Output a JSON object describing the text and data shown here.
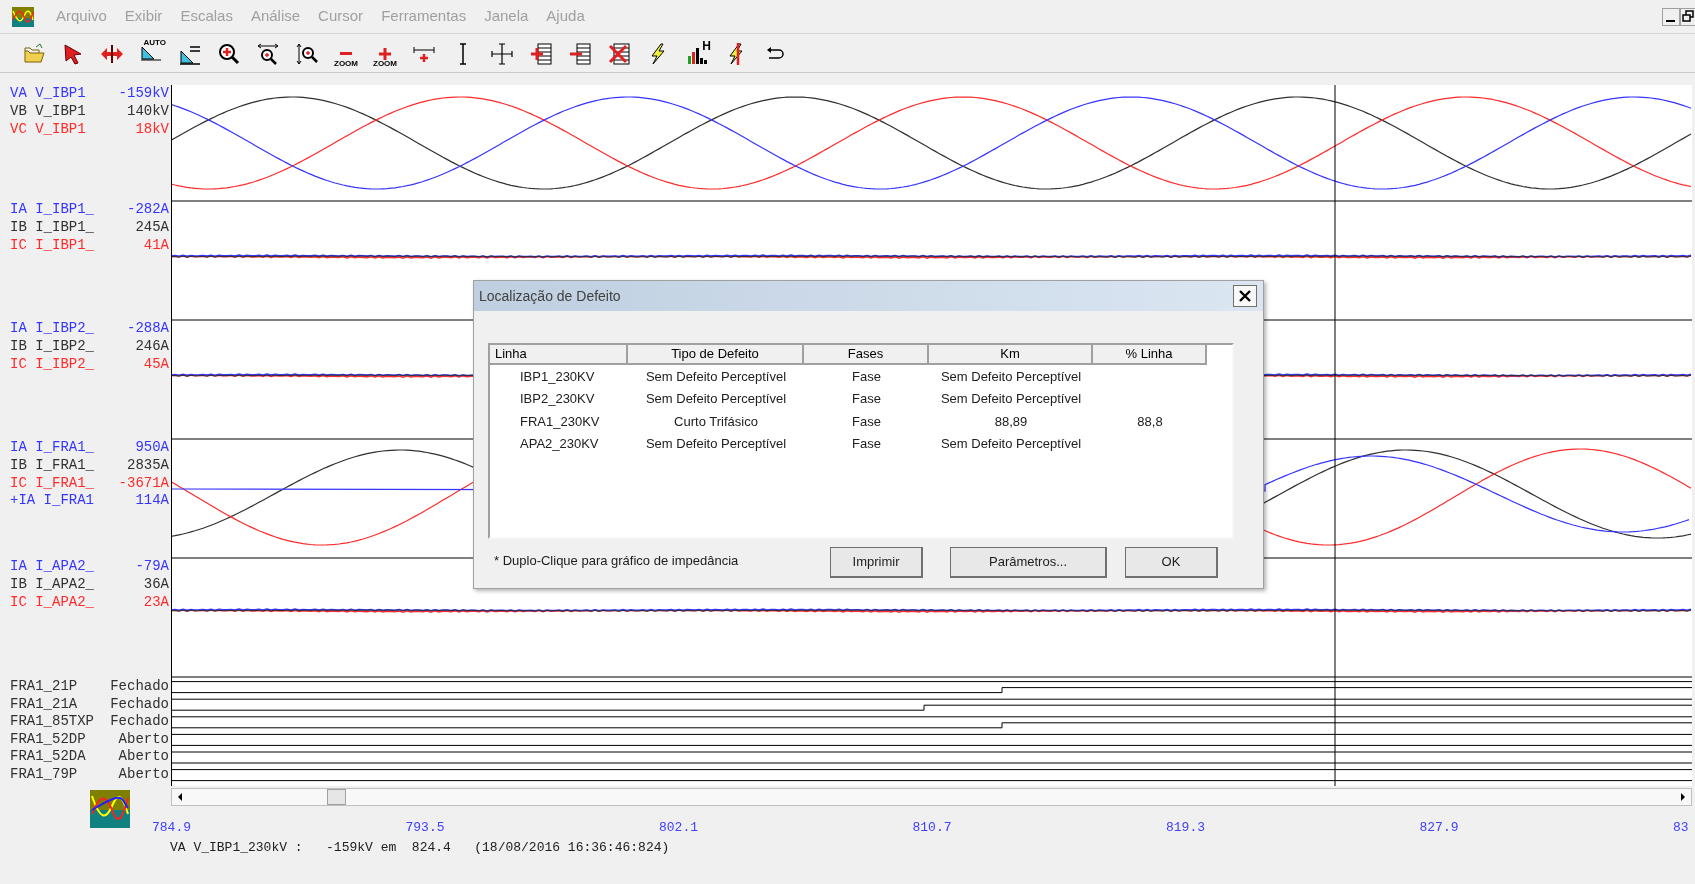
{
  "menu": [
    "Arquivo",
    "Exibir",
    "Escalas",
    "Análise",
    "Cursor",
    "Ferramentas",
    "Janela",
    "Ajuda"
  ],
  "toolbar": [
    {
      "kind": "open"
    },
    {
      "kind": "pointer"
    },
    {
      "kind": "pan"
    },
    {
      "kind": "auto-scale",
      "text": "AUTO"
    },
    {
      "kind": "scale"
    },
    {
      "kind": "zoom-in"
    },
    {
      "kind": "zoom-h"
    },
    {
      "kind": "zoom-v"
    },
    {
      "kind": "zoom-minus",
      "text": "ZOOM"
    },
    {
      "kind": "zoom-plus",
      "text": "ZOOM"
    },
    {
      "kind": "cursor-add"
    },
    {
      "kind": "cursor-i"
    },
    {
      "kind": "crosshair"
    },
    {
      "kind": "channel-add"
    },
    {
      "kind": "channel-remove"
    },
    {
      "kind": "channel-delete"
    },
    {
      "kind": "fault"
    },
    {
      "kind": "harmonics",
      "text": "H"
    },
    {
      "kind": "fault-cross"
    },
    {
      "kind": "undo"
    }
  ],
  "analog_groups": [
    {
      "channels": [
        {
          "label": "VA V_IBP1",
          "value": "-159kV",
          "color": "#3535ff"
        },
        {
          "label": "VB V_IBP1",
          "value": "140kV",
          "color": "#303030"
        },
        {
          "label": "VC V_IBP1",
          "value": "18kV",
          "color": "#ff2a2a"
        }
      ]
    },
    {
      "channels": [
        {
          "label": "IA I_IBP1_",
          "value": "-282A",
          "color": "#3535ff"
        },
        {
          "label": "IB I_IBP1_",
          "value": "245A",
          "color": "#303030"
        },
        {
          "label": "IC I_IBP1_",
          "value": "41A",
          "color": "#ff2a2a"
        }
      ]
    },
    {
      "channels": [
        {
          "label": "IA I_IBP2_",
          "value": "-288A",
          "color": "#3535ff"
        },
        {
          "label": "IB I_IBP2_",
          "value": "246A",
          "color": "#303030"
        },
        {
          "label": "IC I_IBP2_",
          "value": "45A",
          "color": "#ff2a2a"
        }
      ]
    },
    {
      "channels": [
        {
          "label": "IA I_FRA1_",
          "value": "950A",
          "color": "#3535ff"
        },
        {
          "label": "IB I_FRA1_",
          "value": "2835A",
          "color": "#303030"
        },
        {
          "label": "IC I_FRA1_",
          "value": "-3671A",
          "color": "#ff2a2a"
        },
        {
          "label": "+IA I_FRA1",
          "value": "114A",
          "color": "#3535ff"
        }
      ]
    },
    {
      "channels": [
        {
          "label": "IA I_APA2_",
          "value": "-79A",
          "color": "#3535ff"
        },
        {
          "label": "IB I_APA2_",
          "value": "36A",
          "color": "#303030"
        },
        {
          "label": "IC I_APA2_",
          "value": "23A",
          "color": "#ff2a2a"
        }
      ]
    }
  ],
  "digital_channels": [
    {
      "name": "FRA1_21P",
      "state": "Fechado"
    },
    {
      "name": "FRA1_21A",
      "state": "Fechado"
    },
    {
      "name": "FRA1_85TXP",
      "state": "Fechado"
    },
    {
      "name": "FRA1_52DP",
      "state": "Aberto"
    },
    {
      "name": "FRA1_52DA",
      "state": "Aberto"
    },
    {
      "name": "FRA1_79P",
      "state": "Aberto"
    }
  ],
  "time_axis": [
    "784.9",
    "793.5",
    "802.1",
    "810.7",
    "819.3",
    "827.9",
    "83"
  ],
  "status_line": "VA V_IBP1_230kV :   -159kV em  824.4   (18/08/2016 16:36:46:824)",
  "dialog": {
    "title": "Localização de Defeito",
    "columns": [
      "Linha",
      "Tipo de Defeito",
      "Fases",
      "Km",
      "% Linha"
    ],
    "rows": [
      [
        "IBP1_230KV",
        "Sem Defeito Perceptível",
        "Fase",
        "Sem Defeito Perceptível",
        ""
      ],
      [
        "IBP2_230KV",
        "Sem Defeito Perceptível",
        "Fase",
        "Sem Defeito Perceptível",
        ""
      ],
      [
        "FRA1_230KV",
        "Curto Trifásico",
        "Fase",
        "88,89",
        "88,8"
      ],
      [
        "APA2_230KV",
        "Sem Defeito Perceptível",
        "Fase",
        "Sem Defeito Perceptível",
        ""
      ]
    ],
    "note": "* Duplo-Clique para gráfico de impedância",
    "buttons": [
      "Imprimir",
      "Parâmetros...",
      "OK"
    ]
  }
}
